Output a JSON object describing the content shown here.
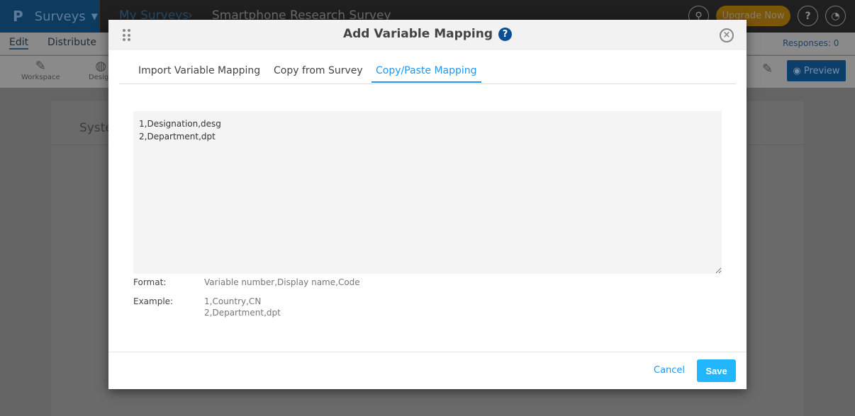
{
  "topbar": {
    "app": "Surveys",
    "breadcrumb": [
      "My Surveys",
      "Smartphone Research Survey"
    ],
    "upgrade": "Upgrade Now",
    "help": "?"
  },
  "subbar": {
    "tabs": [
      "Edit",
      "Distribute"
    ],
    "responses": "Responses: 0"
  },
  "toolbar": {
    "items": [
      "Workspace",
      "Design"
    ],
    "preview": "Preview"
  },
  "page": {
    "section_title": "Syste"
  },
  "modal": {
    "title": "Add Variable Mapping",
    "help": "?",
    "tabs": [
      "Import Variable Mapping",
      "Copy from Survey",
      "Copy/Paste Mapping"
    ],
    "active_tab": "Copy/Paste Mapping",
    "textarea_value": "1,Designation,desg\n2,Department,dpt",
    "format_label": "Format:",
    "format_value": "Variable number,Display name,Code",
    "example_label": "Example:",
    "example_lines": [
      "1,Country,CN",
      "2,Department,dpt"
    ],
    "cancel": "Cancel",
    "save": "Save"
  },
  "colors": {
    "accent": "#2196f3",
    "save": "#22b6ff",
    "help": "#0a4f96"
  }
}
